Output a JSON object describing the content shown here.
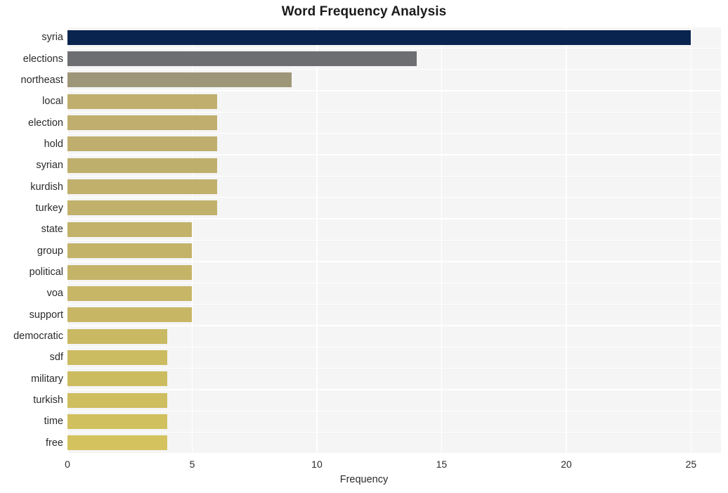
{
  "chart_data": {
    "type": "bar",
    "orientation": "horizontal",
    "title": "Word Frequency Analysis",
    "xlabel": "Frequency",
    "ylabel": "",
    "categories": [
      "syria",
      "elections",
      "northeast",
      "local",
      "election",
      "hold",
      "syrian",
      "kurdish",
      "turkey",
      "state",
      "group",
      "political",
      "voa",
      "support",
      "democratic",
      "sdf",
      "military",
      "turkish",
      "time",
      "free"
    ],
    "values": [
      25,
      14,
      9,
      6,
      6,
      6,
      6,
      6,
      6,
      5,
      5,
      5,
      5,
      5,
      4,
      4,
      4,
      4,
      4,
      4
    ],
    "bar_colors": [
      "#08244f",
      "#6c6e72",
      "#9e9678",
      "#bfae6e",
      "#bfae6e",
      "#bfae6e",
      "#bfaf6d",
      "#c0b06c",
      "#c1b16b",
      "#c2b26a",
      "#c3b369",
      "#c4b467",
      "#c6b666",
      "#c7b764",
      "#c9b962",
      "#cbbb61",
      "#ccbc60",
      "#cebe5f",
      "#d0c05e",
      "#d3c25e"
    ],
    "xlim": [
      0,
      26.2
    ],
    "xticks": [
      0,
      5,
      10,
      15,
      20,
      25
    ],
    "xtick_labels": [
      "0",
      "5",
      "10",
      "15",
      "20",
      "25"
    ],
    "grid": true,
    "grid_color": "#ffffff",
    "plot_background": "#f5f5f6",
    "figure_background": "#ffffff",
    "legend": null
  }
}
